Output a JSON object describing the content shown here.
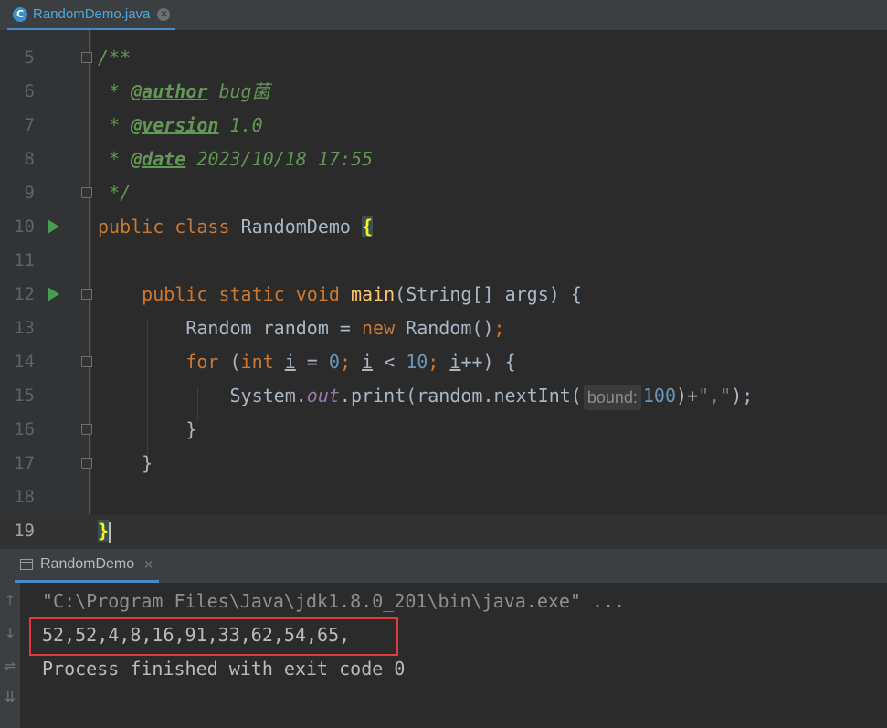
{
  "tab": {
    "icon_letter": "C",
    "label": "RandomDemo.java",
    "close_glyph": "×"
  },
  "editor": {
    "lines": [
      {
        "num": "5"
      },
      {
        "num": "6",
        "star": "* ",
        "tag": "@author",
        "text": " bug菌"
      },
      {
        "num": "7",
        "star": "* ",
        "tag": "@version",
        "text": " 1.0"
      },
      {
        "num": "8",
        "star": "* ",
        "tag": "@date",
        "text": " 2023/10/18 17:55"
      },
      {
        "num": "9",
        "text": "*/"
      },
      {
        "num": "10"
      },
      {
        "num": "11"
      },
      {
        "num": "12"
      },
      {
        "num": "13"
      },
      {
        "num": "14"
      },
      {
        "num": "15"
      },
      {
        "num": "16"
      },
      {
        "num": "17"
      },
      {
        "num": "18"
      },
      {
        "num": "19"
      }
    ],
    "tokens": {
      "doc_open": "/**",
      "kw_public": "public",
      "kw_class": "class",
      "kw_static": "static",
      "kw_void": "void",
      "kw_new": "new",
      "kw_for": "for",
      "kw_int": "int",
      "class_name": "RandomDemo",
      "open_brace": "{",
      "close_brace": "}",
      "main_fn": "main",
      "main_params": "(String[] args) {",
      "random_decl": "Random random = ",
      "random_ctor": "Random()",
      "semicolon": ";",
      "for_paren": " (",
      "var_i": "i",
      "assign_zero": " = ",
      "num_zero": "0",
      "semi_space": "; ",
      "less_than": " < ",
      "num_ten": "10",
      "incr_close": "++) {",
      "system": "System.",
      "out_field": "out",
      "print_call": ".print(random.nextInt(",
      "hint_bound": "bound:",
      "num_hundred": "100",
      "concat": ")+",
      "str_comma": "\",\"",
      "call_end": ");"
    }
  },
  "run_panel": {
    "tab_label": "RandomDemo",
    "close_glyph": "×",
    "console": {
      "command": "\"C:\\Program Files\\Java\\jdk1.8.0_201\\bin\\java.exe\" ...",
      "output": "52,52,4,8,16,91,33,62,54,65,",
      "exit": "Process finished with exit code 0"
    },
    "toolbar": {
      "up": "↑",
      "down": "↓",
      "wrap": "⇌",
      "scroll_end": "⇊"
    }
  },
  "colors": {
    "background": "#2b2b2b",
    "keyword": "#cc7832",
    "doc_comment": "#629755",
    "number": "#6897bb",
    "method": "#ffc66d",
    "highlight_box": "#e0393e"
  }
}
